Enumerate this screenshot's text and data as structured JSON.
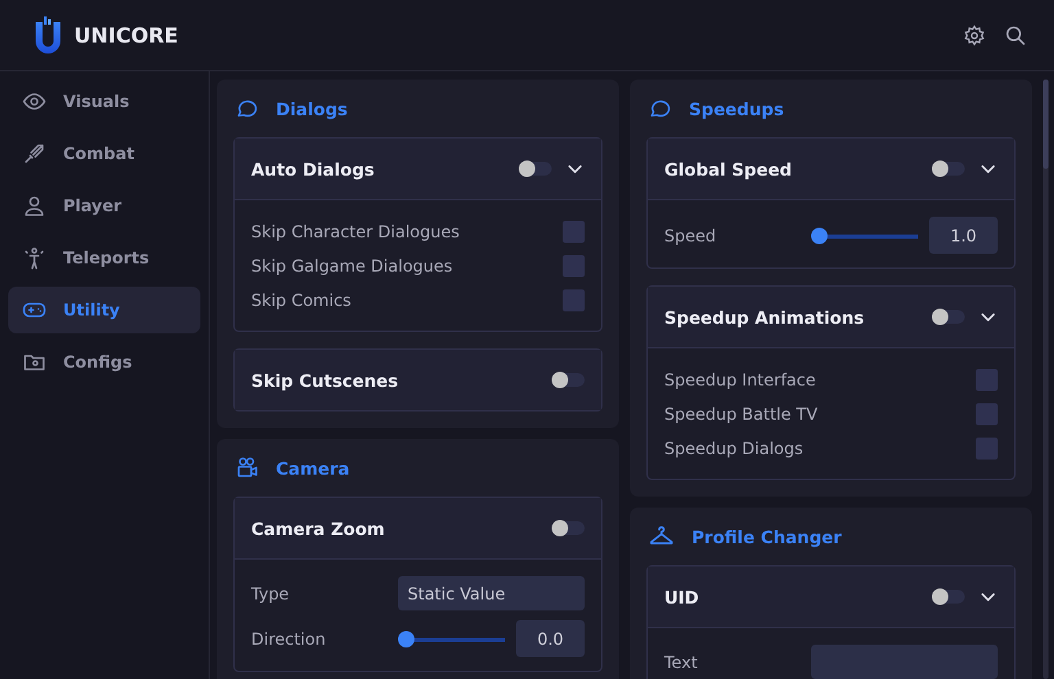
{
  "app": {
    "title": "UNICORE"
  },
  "sidebar": {
    "items": [
      {
        "label": "Visuals",
        "selected": false
      },
      {
        "label": "Combat",
        "selected": false
      },
      {
        "label": "Player",
        "selected": false
      },
      {
        "label": "Teleports",
        "selected": false
      },
      {
        "label": "Utility",
        "selected": true
      },
      {
        "label": "Configs",
        "selected": false
      }
    ]
  },
  "columns": [
    [
      {
        "title": "Dialogs",
        "features": [
          {
            "title": "Auto Dialogs",
            "on": false,
            "has_dropdown": true,
            "rows": [
              {
                "kind": "checkbox",
                "label": "Skip Character Dialogues",
                "checked": false
              },
              {
                "kind": "checkbox",
                "label": "Skip Galgame Dialogues",
                "checked": false
              },
              {
                "kind": "checkbox",
                "label": "Skip Comics",
                "checked": false
              }
            ]
          },
          {
            "title": "Skip Cutscenes",
            "on": false,
            "has_dropdown": false
          }
        ]
      },
      {
        "title": "Camera",
        "features": [
          {
            "title": "Camera Zoom",
            "on": false,
            "has_dropdown": false,
            "rows": [
              {
                "kind": "dropdown",
                "label": "Type",
                "value": "Static Value"
              },
              {
                "kind": "slider",
                "label": "Direction",
                "level": 0,
                "value": "0.0"
              }
            ]
          }
        ]
      }
    ],
    [
      {
        "title": "Speedups",
        "features": [
          {
            "title": "Global Speed",
            "on": false,
            "has_dropdown": true,
            "rows": [
              {
                "kind": "slider",
                "label": "Speed",
                "level": 0,
                "value": "1.0"
              }
            ]
          },
          {
            "title": "Speedup Animations",
            "on": false,
            "has_dropdown": true,
            "rows": [
              {
                "kind": "checkbox",
                "label": "Speedup Interface",
                "checked": false
              },
              {
                "kind": "checkbox",
                "label": "Speedup Battle TV",
                "checked": false
              },
              {
                "kind": "checkbox",
                "label": "Speedup Dialogs",
                "checked": false
              }
            ]
          }
        ]
      },
      {
        "title": "Profile Changer",
        "features": [
          {
            "title": "UID",
            "on": false,
            "has_dropdown": true,
            "rows": [
              {
                "kind": "input",
                "label": "Text"
              }
            ]
          }
        ]
      }
    ]
  ]
}
